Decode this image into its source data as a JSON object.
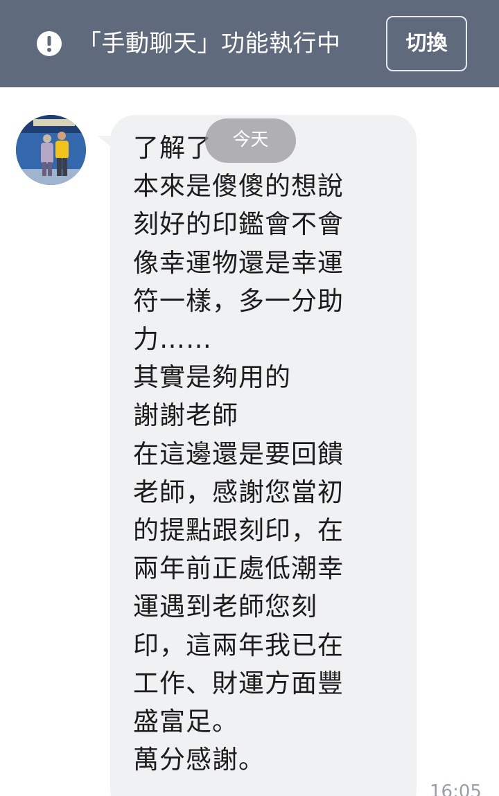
{
  "banner": {
    "text": "「手動聊天」功能執行中",
    "switch_label": "切換",
    "background": "#5f6a7d"
  },
  "chat": {
    "date_separator": "今天",
    "message_lines": [
      "了解了",
      "本來是傻傻的想說",
      "刻好的印鑑會不會",
      "像幸運物還是幸運",
      "符一樣，多一分助",
      "力……",
      "其實是夠用的",
      "謝謝老師",
      "在這邊還是要回饋",
      "老師，感謝您當初",
      "的提點跟刻印，在",
      "兩年前正處低潮幸",
      "運遇到老師您刻",
      "印，這兩年我已在",
      "工作、財運方面豐",
      "盛富足。",
      "萬分感謝。"
    ],
    "timestamp": "16:05",
    "bubble_color": "#f0f1f3"
  },
  "icons": {
    "alert": "alert-circle-icon"
  }
}
